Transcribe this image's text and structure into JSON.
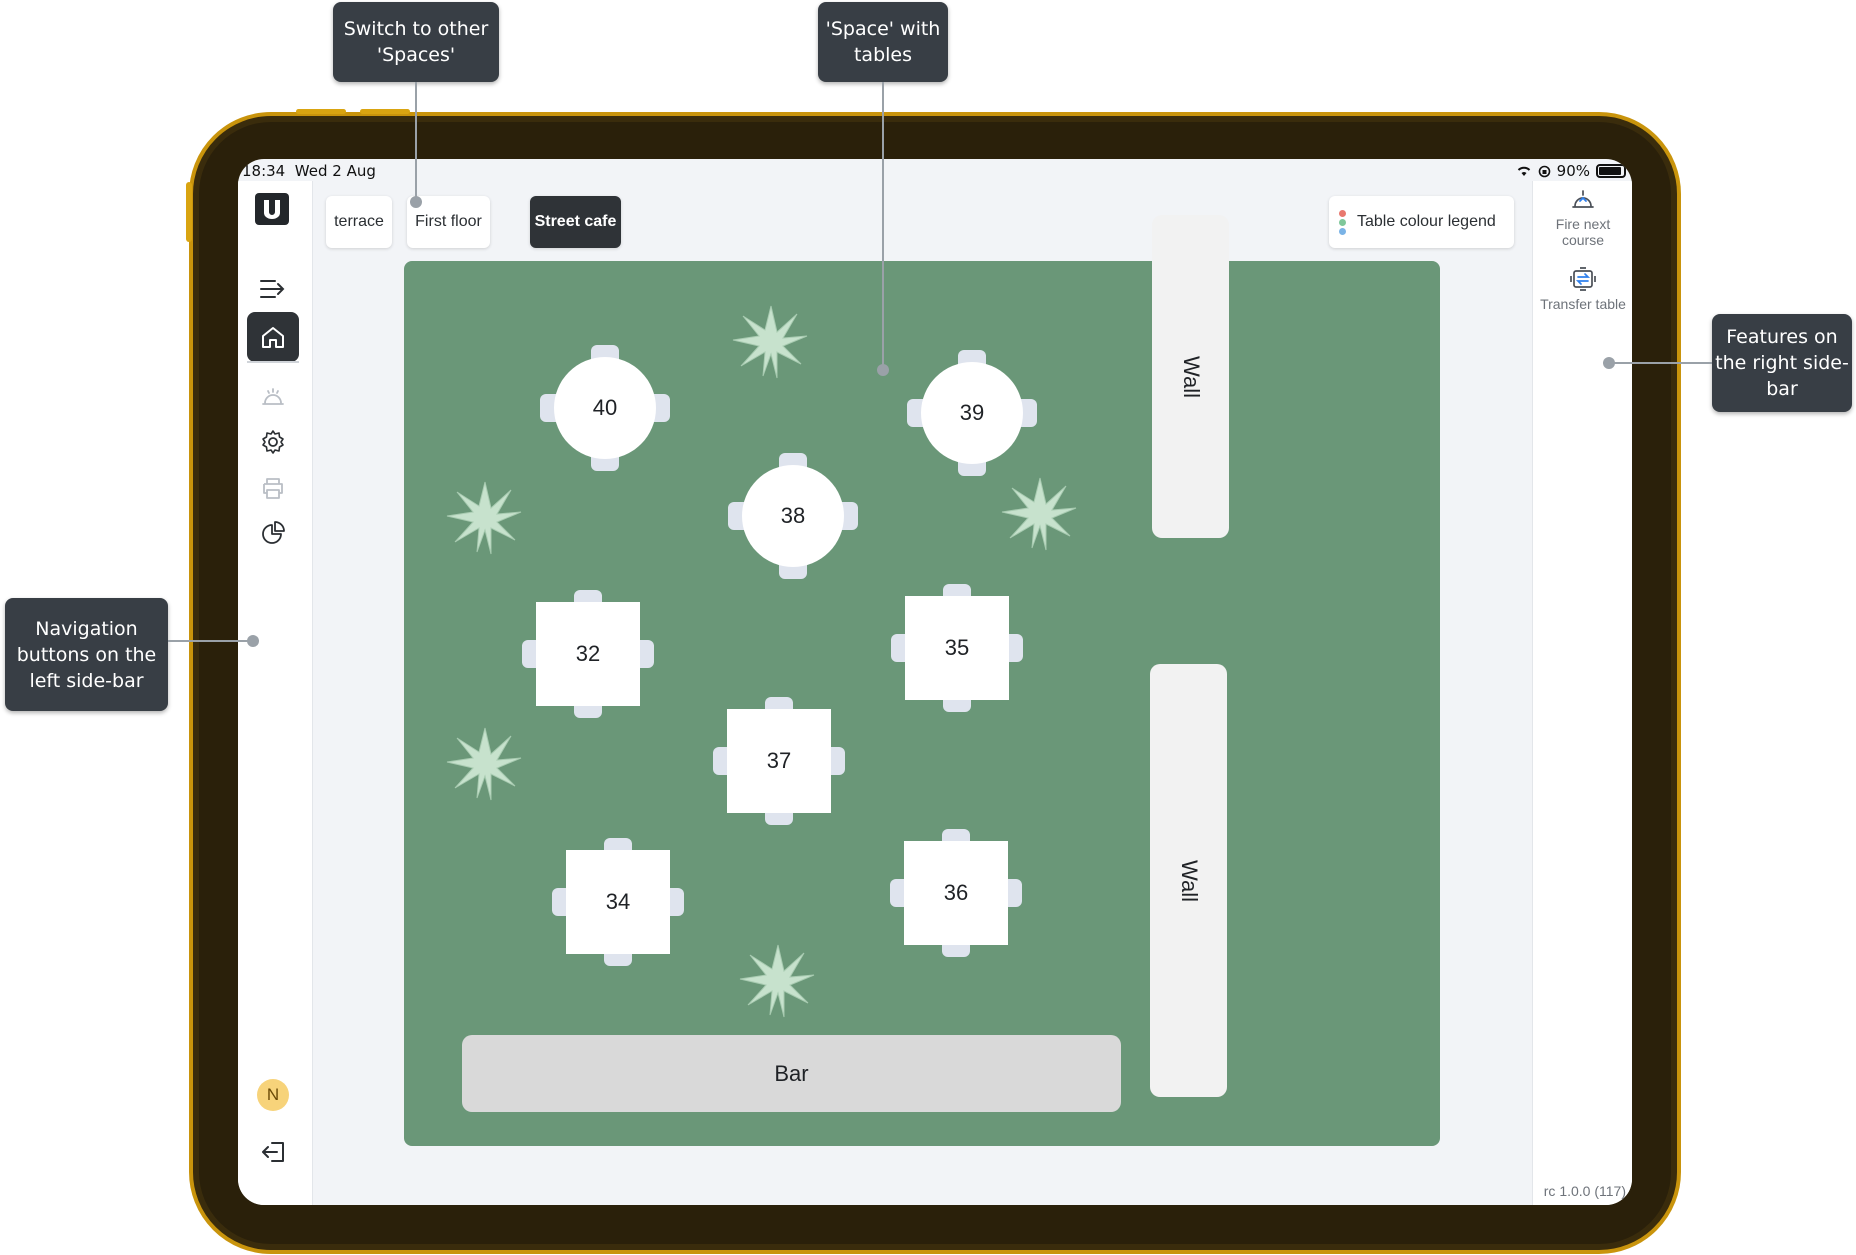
{
  "status_bar": {
    "time": "18:34",
    "date": "Wed 2 Aug",
    "battery": "90%"
  },
  "space_tabs": [
    {
      "label": "terrace",
      "active": false
    },
    {
      "label": "First floor",
      "active": false
    },
    {
      "label": "Street cafe",
      "active": true
    }
  ],
  "legend": {
    "label": "Table colour legend",
    "dot_colors": [
      "#e8786e",
      "#7fc79a",
      "#7ab3e6"
    ]
  },
  "left_nav": {
    "icons": [
      "expand-sidebar-icon",
      "home-icon",
      "service-bell-icon",
      "settings-gear-icon",
      "printer-icon",
      "pie-chart-icon"
    ],
    "active": "home-icon",
    "user_initial": "N",
    "logout_icon": "logout-icon"
  },
  "right_bar": {
    "fire_next_course": "Fire next course",
    "transfer_table": "Transfer table",
    "version": "rc 1.0.0 (117)"
  },
  "floor_plan": {
    "background": "#6a9778",
    "tables": [
      {
        "number": "40",
        "shape": "round"
      },
      {
        "number": "39",
        "shape": "round"
      },
      {
        "number": "38",
        "shape": "round"
      },
      {
        "number": "32",
        "shape": "square"
      },
      {
        "number": "35",
        "shape": "square"
      },
      {
        "number": "37",
        "shape": "square"
      },
      {
        "number": "34",
        "shape": "square"
      },
      {
        "number": "36",
        "shape": "square"
      }
    ],
    "walls": [
      "Wall",
      "Wall"
    ],
    "bar": "Bar"
  },
  "callouts": {
    "spaces": "Switch to other 'Spaces'",
    "space_tables": "'Space' with tables",
    "left_nav": "Navigation buttons on the left side-bar",
    "right_features": "Features on the right side-bar"
  }
}
